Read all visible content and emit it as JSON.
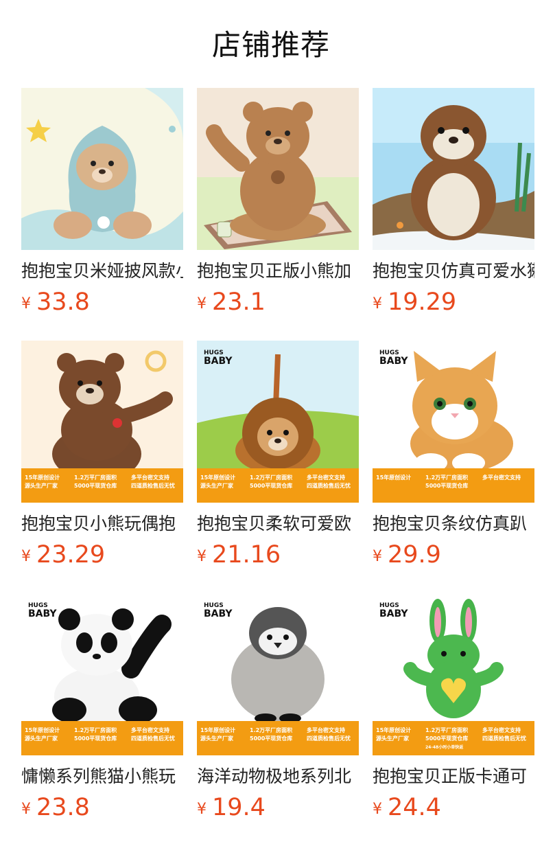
{
  "section_title": "店铺推荐",
  "currency_symbol": "¥",
  "products": [
    {
      "name": "抱抱宝贝米娅披风款小熊",
      "price": "33.8",
      "image_icon": "teddy-bear-blue-hoodie"
    },
    {
      "name": "抱抱宝贝正版小熊加",
      "price": "23.1",
      "image_icon": "brown-teddy-bear"
    },
    {
      "name": "抱抱宝贝仿真可爱水獭",
      "price": "19.29",
      "image_icon": "otter-plush"
    },
    {
      "name": "抱抱宝贝小熊玩偶抱",
      "price": "23.29",
      "image_icon": "brown-bear-plush"
    },
    {
      "name": "抱抱宝贝柔软可爱欧",
      "price": "21.16",
      "image_icon": "lion-plush"
    },
    {
      "name": "抱抱宝贝条纹仿真趴",
      "price": "29.9",
      "image_icon": "orange-cat-plush"
    },
    {
      "name": "慵懒系列熊猫小熊玩",
      "price": "23.8",
      "image_icon": "panda-plush"
    },
    {
      "name": "海洋动物极地系列北",
      "price": "19.4",
      "image_icon": "penguin-plush"
    },
    {
      "name": "抱抱宝贝正版卡通可",
      "price": "24.4",
      "image_icon": "green-rabbit-plush"
    }
  ],
  "banner": {
    "brand_top": "HUGS",
    "brand_bottom": "BABY",
    "col1_line1": "15年原创设计",
    "col1_line2": "源头生产厂家",
    "col2_line1": "1.2万平厂房面积",
    "col2_line2": "5000平现货仓库",
    "col3_line1": "多平台密文支持",
    "col3_line2": "四道质检售后无忧",
    "col2_line3": "24-48小时小单快返"
  },
  "colors": {
    "price": "#e8491d",
    "banner": "#f39c12"
  }
}
